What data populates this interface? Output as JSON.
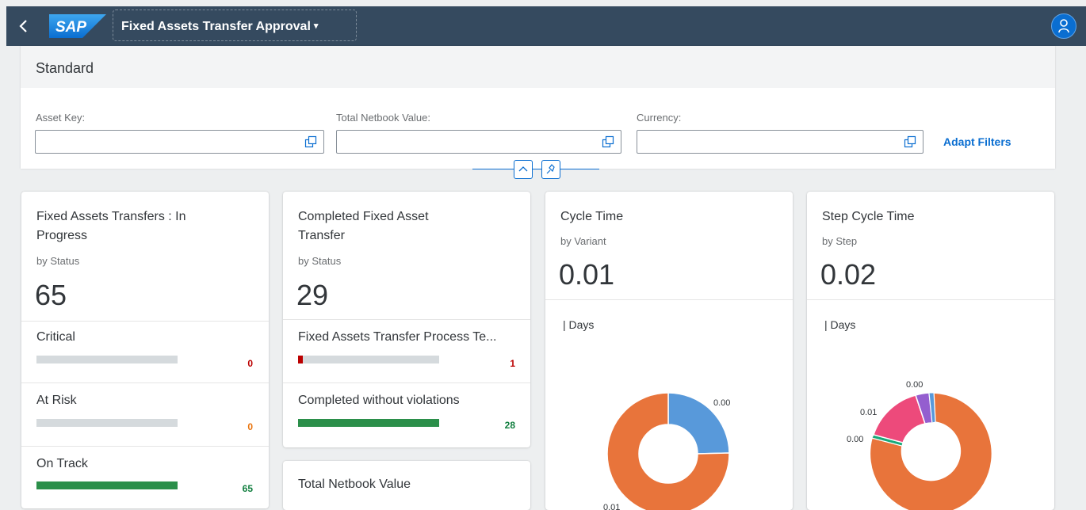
{
  "shell": {
    "back_icon": "back-chevron-icon",
    "logo_text": "SAP",
    "app_title": "Fixed Assets Transfer Approval",
    "title_caret": "▾",
    "avatar_icon": "user-icon",
    "brand_color": "#354a5f"
  },
  "filterbar": {
    "variant": "Standard",
    "filters": [
      {
        "label": "Asset Key:",
        "value": ""
      },
      {
        "label": "Total Netbook Value:",
        "value": ""
      },
      {
        "label": "Currency:",
        "value": ""
      }
    ],
    "adapt_filters": "Adapt Filters",
    "collapse_icon": "collapse-up-icon",
    "pin_icon": "pin-icon"
  },
  "cards": {
    "in_progress": {
      "title_line1": "Fixed Assets Transfers : In",
      "title_line2": "Progress",
      "subtitle": "by Status",
      "kpi": "65",
      "rows": [
        {
          "label": "Critical",
          "value": "0",
          "fraction": 0,
          "color": "#bb0000"
        },
        {
          "label": "At Risk",
          "value": "0",
          "fraction": 0,
          "color": "#e9730c"
        },
        {
          "label": "On Track",
          "value": "65",
          "fraction": 1,
          "color": "#107e3e"
        }
      ]
    },
    "completed": {
      "title_line1": "Completed Fixed Asset",
      "title_line2": "Transfer",
      "subtitle": "by Status",
      "kpi": "29",
      "rows": [
        {
          "label": "Fixed Assets Transfer Process Te...",
          "value": "1",
          "fraction": 0.034,
          "color": "#bb0000"
        },
        {
          "label": "Completed without violations",
          "value": "28",
          "fraction": 1,
          "color": "#107e3e"
        }
      ]
    },
    "netbook": {
      "title": "Total Netbook Value"
    },
    "cycle_time": {
      "title": "Cycle Time",
      "subtitle": "by Variant",
      "kpi": "0.01",
      "unit": "| Days",
      "chart_data": {
        "type": "pie",
        "slices": [
          {
            "value": 0.0,
            "label": "0.00",
            "color": "#5899da"
          },
          {
            "value": 0.01,
            "label": "0.01",
            "color": "#e8743b"
          }
        ]
      }
    },
    "step_cycle_time": {
      "title": "Step Cycle Time",
      "subtitle": "by Step",
      "kpi": "0.02",
      "unit": "| Days",
      "chart_data": {
        "type": "pie",
        "slices": [
          {
            "label": "0.00",
            "color": "#5899da"
          },
          {
            "label": "0.01",
            "color": "#e8743b"
          },
          {
            "label": "0.00",
            "color": "#19a979"
          },
          {
            "label": "0.01",
            "color": "#ed4a7b"
          },
          {
            "label": "0.00",
            "color": "#945ecf"
          }
        ]
      }
    }
  }
}
